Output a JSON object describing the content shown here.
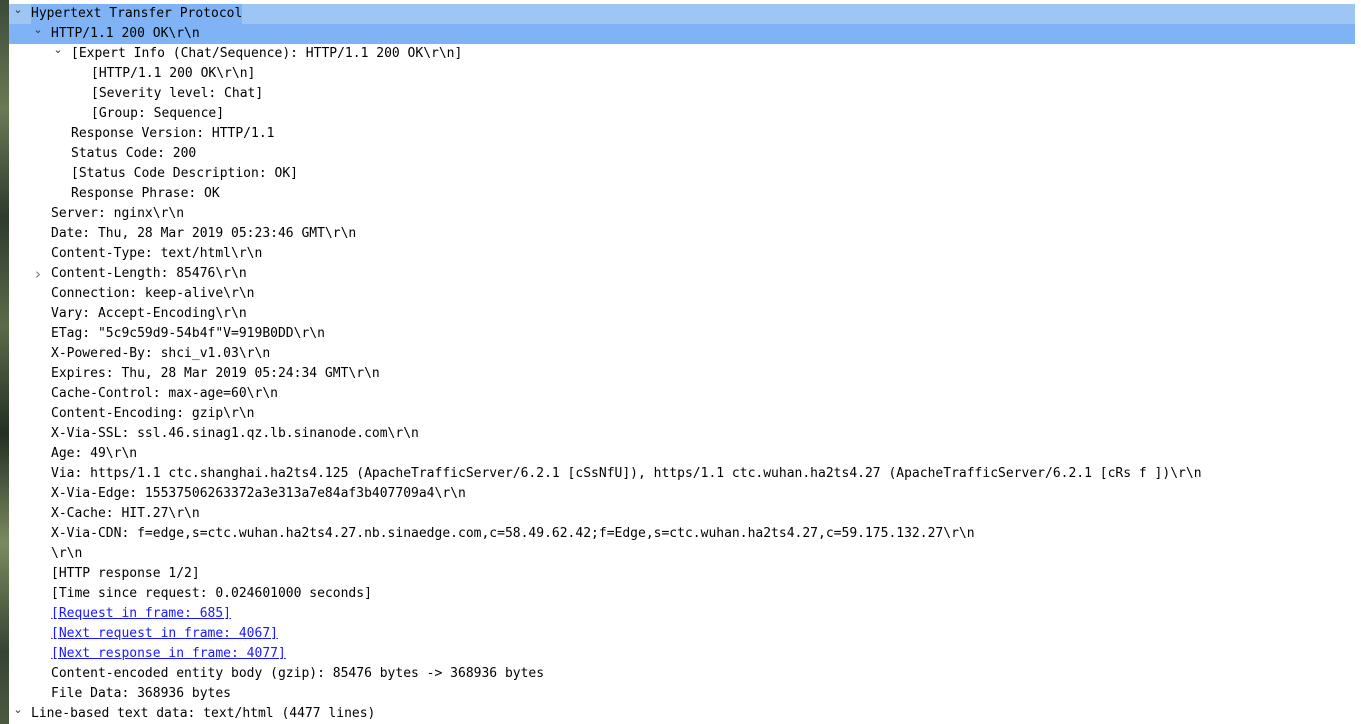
{
  "top_clipped": "[                                                                                                                                                                                    ]",
  "rows": [
    {
      "text": "Hypertext Transfer Protocol",
      "indent": 0,
      "twisty": "open",
      "selected": "header"
    },
    {
      "text": "HTTP/1.1 200 OK\\r\\n",
      "indent": 1,
      "twisty": "open",
      "selected": "row"
    },
    {
      "text": "[Expert Info (Chat/Sequence): HTTP/1.1 200 OK\\r\\n]",
      "indent": 2,
      "twisty": "open"
    },
    {
      "text": "[HTTP/1.1 200 OK\\r\\n]",
      "indent": 3
    },
    {
      "text": "[Severity level: Chat]",
      "indent": 3
    },
    {
      "text": "[Group: Sequence]",
      "indent": 3
    },
    {
      "text": "Response Version: HTTP/1.1",
      "indent": 2
    },
    {
      "text": "Status Code: 200",
      "indent": 2
    },
    {
      "text": "[Status Code Description: OK]",
      "indent": 2
    },
    {
      "text": "Response Phrase: OK",
      "indent": 2
    },
    {
      "text": "Server: nginx\\r\\n",
      "indent": 1
    },
    {
      "text": "Date: Thu, 28 Mar 2019 05:23:46 GMT\\r\\n",
      "indent": 1
    },
    {
      "text": "Content-Type: text/html\\r\\n",
      "indent": 1
    },
    {
      "text": "Content-Length: 85476\\r\\n",
      "indent": 1,
      "twisty": "closed"
    },
    {
      "text": "Connection: keep-alive\\r\\n",
      "indent": 1
    },
    {
      "text": "Vary: Accept-Encoding\\r\\n",
      "indent": 1
    },
    {
      "text": "ETag: \"5c9c59d9-54b4f\"V=919B0DD\\r\\n",
      "indent": 1
    },
    {
      "text": "X-Powered-By: shci_v1.03\\r\\n",
      "indent": 1
    },
    {
      "text": "Expires: Thu, 28 Mar 2019 05:24:34 GMT\\r\\n",
      "indent": 1
    },
    {
      "text": "Cache-Control: max-age=60\\r\\n",
      "indent": 1
    },
    {
      "text": "Content-Encoding: gzip\\r\\n",
      "indent": 1
    },
    {
      "text": "X-Via-SSL: ssl.46.sinag1.qz.lb.sinanode.com\\r\\n",
      "indent": 1
    },
    {
      "text": "Age: 49\\r\\n",
      "indent": 1
    },
    {
      "text": "Via: https/1.1 ctc.shanghai.ha2ts4.125 (ApacheTrafficServer/6.2.1 [cSsNfU]), https/1.1 ctc.wuhan.ha2ts4.27 (ApacheTrafficServer/6.2.1 [cRs f ])\\r\\n",
      "indent": 1
    },
    {
      "text": "X-Via-Edge: 15537506263372a3e313a7e84af3b407709a4\\r\\n",
      "indent": 1
    },
    {
      "text": "X-Cache: HIT.27\\r\\n",
      "indent": 1
    },
    {
      "text": "X-Via-CDN: f=edge,s=ctc.wuhan.ha2ts4.27.nb.sinaedge.com,c=58.49.62.42;f=Edge,s=ctc.wuhan.ha2ts4.27,c=59.175.132.27\\r\\n",
      "indent": 1
    },
    {
      "text": "\\r\\n",
      "indent": 1
    },
    {
      "text": "[HTTP response 1/2]",
      "indent": 1
    },
    {
      "text": "[Time since request: 0.024601000 seconds]",
      "indent": 1
    },
    {
      "text": "[Request in frame: 685]",
      "indent": 1,
      "link": true
    },
    {
      "text": "[Next request in frame: 4067]",
      "indent": 1,
      "link": true
    },
    {
      "text": "[Next response in frame: 4077]",
      "indent": 1,
      "link": true
    },
    {
      "text": "Content-encoded entity body (gzip): 85476 bytes -> 368936 bytes",
      "indent": 1
    },
    {
      "text": "File Data: 368936 bytes",
      "indent": 1
    },
    {
      "text": "Line-based text data: text/html (4477 lines)",
      "indent": 0,
      "twisty": "open"
    }
  ]
}
